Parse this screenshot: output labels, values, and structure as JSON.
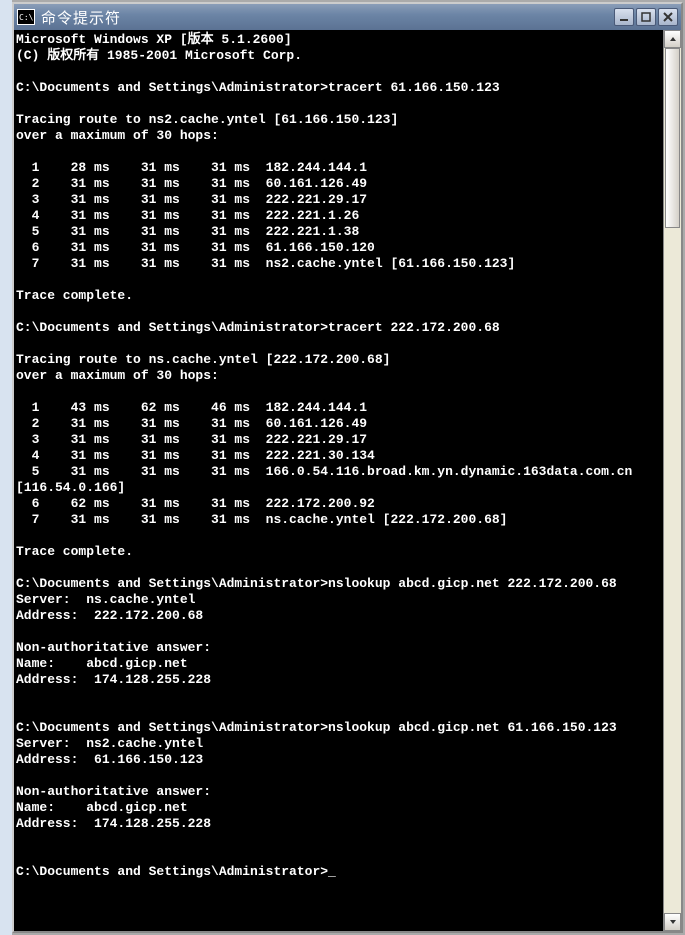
{
  "window": {
    "title": "命令提示符"
  },
  "cmd": {
    "header1": "Microsoft Windows XP [版本 5.1.2600]",
    "header2": "(C) 版权所有 1985-2001 Microsoft Corp.",
    "prompt": "C:\\Documents and Settings\\Administrator>",
    "trace1_cmd": "tracert 61.166.150.123",
    "trace1_head1": "Tracing route to ns2.cache.yntel [61.166.150.123]",
    "trace1_head2": "over a maximum of 30 hops:",
    "trace1_hops": [
      [
        "1",
        "28 ms",
        "31 ms",
        "31 ms",
        "182.244.144.1"
      ],
      [
        "2",
        "31 ms",
        "31 ms",
        "31 ms",
        "60.161.126.49"
      ],
      [
        "3",
        "31 ms",
        "31 ms",
        "31 ms",
        "222.221.29.17"
      ],
      [
        "4",
        "31 ms",
        "31 ms",
        "31 ms",
        "222.221.1.26"
      ],
      [
        "5",
        "31 ms",
        "31 ms",
        "31 ms",
        "222.221.1.38"
      ],
      [
        "6",
        "31 ms",
        "31 ms",
        "31 ms",
        "61.166.150.120"
      ],
      [
        "7",
        "31 ms",
        "31 ms",
        "31 ms",
        "ns2.cache.yntel [61.166.150.123]"
      ]
    ],
    "trace_done": "Trace complete.",
    "trace2_cmd": "tracert 222.172.200.68",
    "trace2_head1": "Tracing route to ns.cache.yntel [222.172.200.68]",
    "trace2_head2": "over a maximum of 30 hops:",
    "trace2_hops": [
      [
        "1",
        "43 ms",
        "62 ms",
        "46 ms",
        "182.244.144.1"
      ],
      [
        "2",
        "31 ms",
        "31 ms",
        "31 ms",
        "60.161.126.49"
      ],
      [
        "3",
        "31 ms",
        "31 ms",
        "31 ms",
        "222.221.29.17"
      ],
      [
        "4",
        "31 ms",
        "31 ms",
        "31 ms",
        "222.221.30.134"
      ],
      [
        "5",
        "31 ms",
        "31 ms",
        "31 ms",
        "166.0.54.116.broad.km.yn.dynamic.163data.com.cn"
      ]
    ],
    "trace2_wrap": "[116.54.0.166]",
    "trace2_hops_b": [
      [
        "6",
        "62 ms",
        "31 ms",
        "31 ms",
        "222.172.200.92"
      ],
      [
        "7",
        "31 ms",
        "31 ms",
        "31 ms",
        "ns.cache.yntel [222.172.200.68]"
      ]
    ],
    "ns1_cmd": "nslookup abcd.gicp.net 222.172.200.68",
    "ns1_server": "Server:  ns.cache.yntel",
    "ns1_addr": "Address:  222.172.200.68",
    "ns_nonauth": "Non-authoritative answer:",
    "ns1_name": "Name:    abcd.gicp.net",
    "ns1_raddr": "Address:  174.128.255.228",
    "ns2_cmd": "nslookup abcd.gicp.net 61.166.150.123",
    "ns2_server": "Server:  ns2.cache.yntel",
    "ns2_addr": "Address:  61.166.150.123",
    "ns2_name": "Name:    abcd.gicp.net",
    "ns2_raddr": "Address:  174.128.255.228",
    "cursor": "_"
  }
}
